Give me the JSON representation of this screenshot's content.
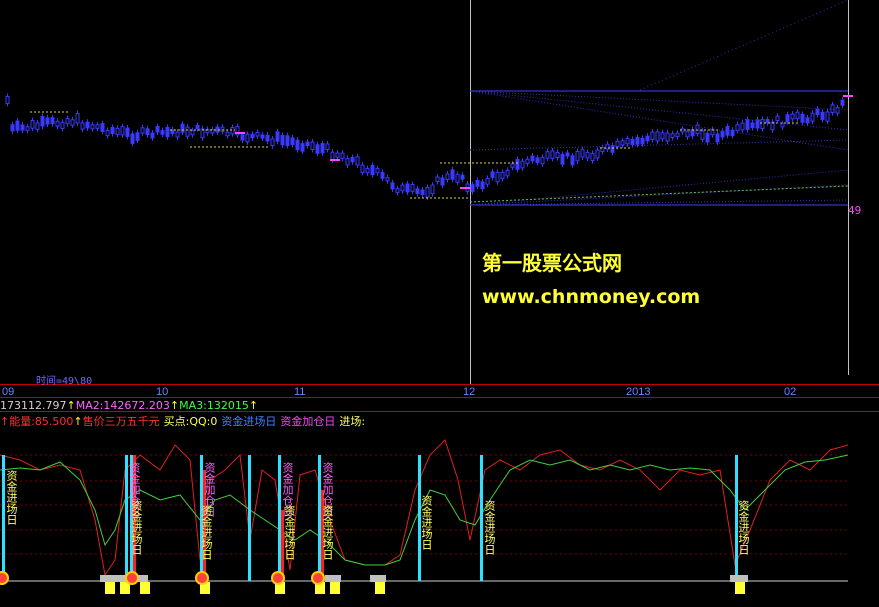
{
  "watermark": {
    "line1": "第一股票公式网",
    "line2": "www.chnmoney.com"
  },
  "chart_top": {
    "price_label": "49",
    "time_label": "时间=49\\80"
  },
  "x_axis": {
    "labels": [
      "09",
      "10",
      "11",
      "12",
      "2013",
      "02"
    ]
  },
  "ma_line": {
    "ma1": "173112.797",
    "ma2": "MA2:142672.203",
    "ma3": "MA3:132015"
  },
  "indicator_line": {
    "energy": "能量:85.500",
    "price": "售价三万五千元",
    "buy_point": "买点:QQ:0",
    "fund_in": "资金进场日",
    "fund_add": "资金加仓日",
    "entry": "进场:"
  },
  "signal_labels": {
    "fund_in": "资金进场日",
    "fund_add": "资金加仓日"
  },
  "colors": {
    "background": "#000000",
    "axis_line": "#c00000",
    "candle": "#3a3aff",
    "energy_line": "#e02020",
    "green_line": "#40d040",
    "cyan_bar": "#30e0ff",
    "yellow": "#ffff33",
    "magenta": "#ff44ff"
  }
}
